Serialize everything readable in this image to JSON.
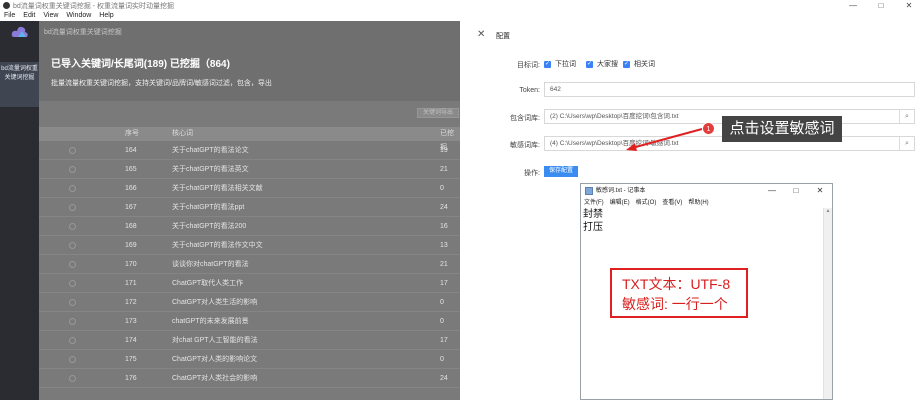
{
  "window": {
    "title": "bd流量词权重关键词挖掘 - 权重流量词实时动量挖掘",
    "controls": [
      "—",
      "□",
      "✕"
    ]
  },
  "menubar": [
    "File",
    "Edit",
    "View",
    "Window",
    "Help"
  ],
  "sidebar": {
    "logo": "cloud-logo-icon",
    "active_item": "bd流量词权重关键词挖掘"
  },
  "left": {
    "breadcrumb": "bd流量词权重关键词挖掘",
    "title": "已导入关键词/长尾词(189) 已挖掘（864)",
    "desc": "批量流量权重关键词挖掘，支持关键词/品牌词/敏感词过滤，包含，导出",
    "export_label": "关键词导出",
    "columns": [
      "",
      "序号",
      "核心词",
      "已挖掘"
    ],
    "rows": [
      [
        "164",
        "关于chatGPT的看法论文",
        "19"
      ],
      [
        "165",
        "关于chatGPT的看法英文",
        "21"
      ],
      [
        "166",
        "关于chatGPT的看法相关文献",
        "0"
      ],
      [
        "167",
        "关于chatGPT的看法ppt",
        "24"
      ],
      [
        "168",
        "关于chatGPT的看法200",
        "16"
      ],
      [
        "169",
        "关于chatGPT的看法作文中文",
        "13"
      ],
      [
        "170",
        "谈谈你对chatGPT的看法",
        "21"
      ],
      [
        "171",
        "ChatGPT取代人类工作",
        "17"
      ],
      [
        "172",
        "ChatGPT对人类生活的影响",
        "0"
      ],
      [
        "173",
        "chatGPT的未来发展前景",
        "0"
      ],
      [
        "174",
        "对chat GPT人工智能的看法",
        "17"
      ],
      [
        "175",
        "ChatGPT对人类的影响论文",
        "0"
      ],
      [
        "176",
        "ChatGPT对人类社会的影响",
        "24"
      ]
    ]
  },
  "config": {
    "title": "配置",
    "target_label": "目标词:",
    "target_options": [
      "下拉词",
      "大家搜",
      "相关词"
    ],
    "token_label": "Token:",
    "token_value": "642",
    "include_label": "包含词库:",
    "include_value": "(2) C:\\Users\\wp\\Desktop\\百度挖词\\包含词.txt",
    "sensitive_label": "敏感词库:",
    "sensitive_value": "(4) C:\\Users\\wp\\Desktop\\百度挖词\\敏感词.txt",
    "op_label": "操作:",
    "save_label": "保存配置"
  },
  "annotation": {
    "badge": "1",
    "callout": "点击设置敏感词",
    "note_line1": "TXT文本：UTF-8",
    "note_line2": "敏感词: 一行一个"
  },
  "notepad": {
    "title": "敏感词.txt - 记事本",
    "menu": [
      "文件(F)",
      "编辑(E)",
      "格式(O)",
      "查看(V)",
      "帮助(H)"
    ],
    "lines": [
      "封禁",
      "打压"
    ],
    "controls": [
      "—",
      "□",
      "✕"
    ]
  },
  "colors": {
    "accent": "#3b8cf0",
    "annotation": "#e02020",
    "sidebar": "#2a2c31"
  }
}
